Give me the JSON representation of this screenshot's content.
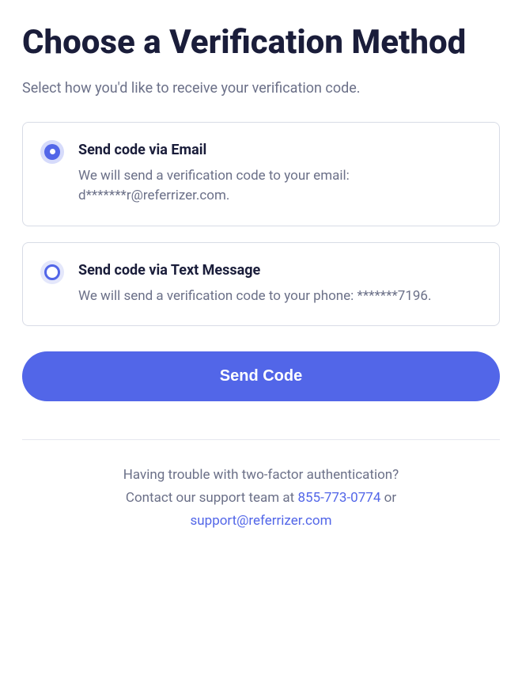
{
  "header": {
    "title": "Choose a Verification Method",
    "subtitle": "Select how you'd like to receive your verification code."
  },
  "options": {
    "email": {
      "title": "Send code via Email",
      "description": "We will send a verification code to your email: d*******r@referrizer.com.",
      "selected": true
    },
    "sms": {
      "title": "Send code via Text Message",
      "description": "We will send a verification code to your phone: *******7196.",
      "selected": false
    }
  },
  "actions": {
    "send_label": "Send Code"
  },
  "help": {
    "line1": "Having trouble with two-factor authentication?",
    "line2_prefix": "Contact our support team at ",
    "phone": "855-773-0774",
    "line2_suffix": " or",
    "email": "support@referrizer.com"
  }
}
